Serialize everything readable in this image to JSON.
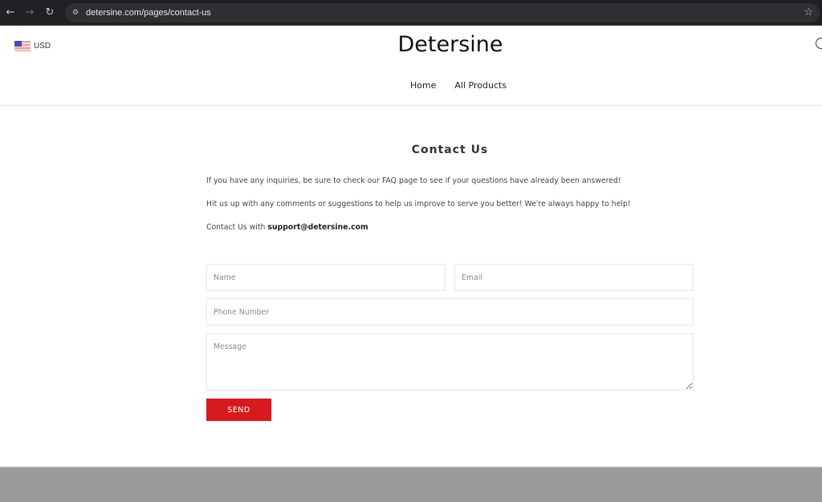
{
  "browser": {
    "url": "detersine.com/pages/contact-us",
    "back_icon": "←",
    "forward_icon": "→",
    "reload_icon": "↻",
    "site_info_icon": "⚙",
    "bookmark_icon": "☆"
  },
  "header": {
    "currency": "USD",
    "brand": "Detersine",
    "nav": [
      {
        "label": "Home"
      },
      {
        "label": "All Products"
      }
    ]
  },
  "contact": {
    "title": "Contact Us",
    "paragraph1": "If you have any inquiries, be sure to check our FAQ page to see if your questions have already been answered!",
    "paragraph2": "Hit us up with any comments or suggestions to help us improve to serve you better! We're always happy to help!",
    "paragraph3_prefix": "Contact Us with ",
    "email": "support@detersine.com",
    "form": {
      "name_placeholder": "Name",
      "email_placeholder": "Email",
      "phone_placeholder": "Phone Number",
      "message_placeholder": "Message",
      "send_label": "SEND"
    }
  },
  "colors": {
    "accent": "#d71a1f",
    "footer": "#9b9b9b"
  }
}
